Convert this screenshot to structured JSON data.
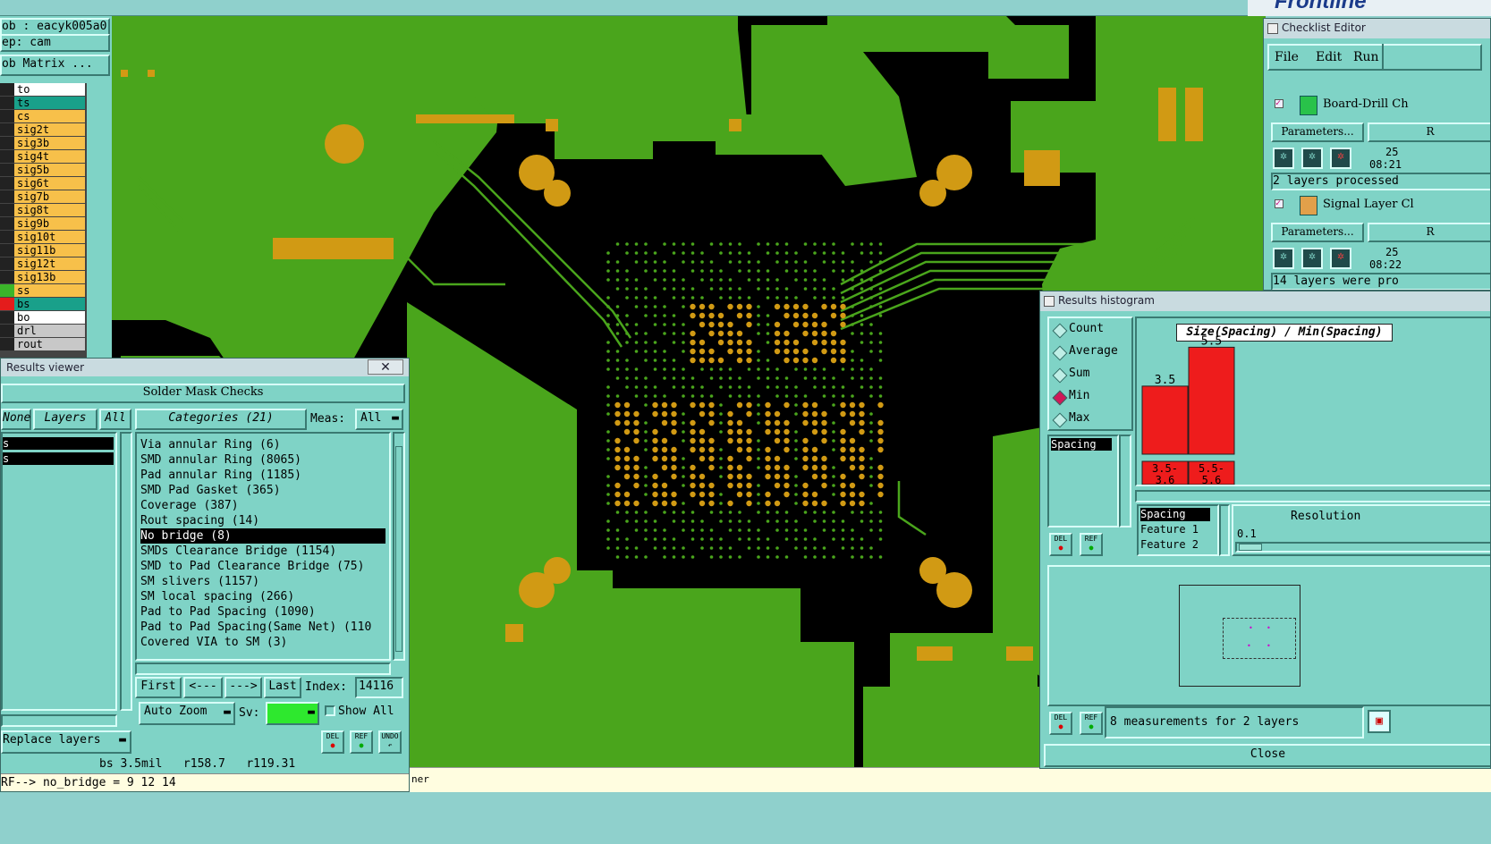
{
  "colors": {
    "pcb_bg": "#000000",
    "copper": "#4aa51c",
    "pad": "#d19a14",
    "panel": "#7fd3c6",
    "select": "#000000",
    "bar": "#ee1c1c"
  },
  "job": {
    "name": "ob : eacyk005a0",
    "step": "ep: cam",
    "matrix_btn": "ob Matrix ..."
  },
  "layers": [
    {
      "name": "to",
      "color": "#ffffff"
    },
    {
      "name": "ts",
      "color": "#19a08a"
    },
    {
      "name": "cs",
      "color": "#f7c04a"
    },
    {
      "name": "sig2t",
      "color": "#f7c04a"
    },
    {
      "name": "sig3b",
      "color": "#f7c04a"
    },
    {
      "name": "sig4t",
      "color": "#f7c04a"
    },
    {
      "name": "sig5b",
      "color": "#f7c04a"
    },
    {
      "name": "sig6t",
      "color": "#f7c04a"
    },
    {
      "name": "sig7b",
      "color": "#f7c04a"
    },
    {
      "name": "sig8t",
      "color": "#f7c04a"
    },
    {
      "name": "sig9b",
      "color": "#f7c04a"
    },
    {
      "name": "sig10t",
      "color": "#f7c04a"
    },
    {
      "name": "sig11b",
      "color": "#f7c04a"
    },
    {
      "name": "sig12t",
      "color": "#f7c04a"
    },
    {
      "name": "sig13b",
      "color": "#f7c04a"
    },
    {
      "name": "ss",
      "color": "#f7c04a"
    },
    {
      "name": "bs",
      "color": "#19a08a"
    },
    {
      "name": "bo",
      "color": "#ffffff"
    },
    {
      "name": "drl",
      "color": "#c8c8c8"
    },
    {
      "name": "rout",
      "color": "#c8c8c8"
    }
  ],
  "results_viewer": {
    "title": "Results viewer",
    "header": "Solder Mask Checks",
    "none_btn": "None",
    "layers_btn": "Layers",
    "all_btn": "All",
    "categories_label": "Categories (21)",
    "meas_label": "Meas:",
    "meas_value": "All",
    "layer_items": [
      "s",
      "s"
    ],
    "categories": [
      "Via annular Ring (6)",
      "SMD annular Ring (8065)",
      "Pad annular Ring (1185)",
      "SMD Pad Gasket (365)",
      "Coverage (387)",
      "Rout spacing (14)",
      "No bridge (8)",
      "SMDs Clearance Bridge (1154)",
      "SMD to Pad Clearance Bridge (75)",
      "SM slivers (1157)",
      "SM local spacing (266)",
      "Pad to Pad Spacing (1090)",
      "Pad to Pad Spacing(Same Net) (110",
      "Covered VIA to SM (3)"
    ],
    "selected_index": 6,
    "first": "First",
    "prev": "<---",
    "next": "--->",
    "last": "Last",
    "index_label": "Index:",
    "index_value": "14116",
    "auto_zoom": "Auto Zoom",
    "sv_label": "Sv:",
    "show_all": "Show All",
    "replace_layers": "Replace layers",
    "del": "DEL",
    "ref": "REF",
    "undo": "UNDO",
    "status": "bs 3.5mil   r158.7   r119.31",
    "command": "RF--> no_bridge = 9 12 14"
  },
  "checklist": {
    "title": "Checklist Editor",
    "menu": [
      "File",
      "Edit",
      "Run"
    ],
    "items": [
      {
        "name": "Board-Drill Ch",
        "params": "Parameters...",
        "r": "R",
        "date": "25",
        "time": "08:21",
        "msg": "2 layers processed"
      },
      {
        "name": "Signal Layer Cl",
        "params": "Parameters...",
        "r": "R",
        "date": "25",
        "time": "08:22",
        "msg": "14 layers were pro"
      }
    ]
  },
  "histogram": {
    "title": "Results histogram",
    "modes": [
      "Count",
      "Average",
      "Sum",
      "Min",
      "Max"
    ],
    "selected_mode": "Min",
    "chart_title": "Size(Spacing) / Min(Spacing)",
    "list_item": "Spacing",
    "fields": [
      "Spacing",
      "Feature 1",
      "Feature 2"
    ],
    "resolution_label": "Resolution",
    "resolution_value": "0.1",
    "measurements": "8 measurements for 2 layers",
    "close": "Close",
    "del": "DEL",
    "ref": "REF"
  },
  "chart_data": {
    "type": "bar",
    "categories": [
      "3.5-\n3.6",
      "5.5-\n5.6"
    ],
    "values": [
      3.5,
      5.5
    ],
    "title": "Size(Spacing) / Min(Spacing)",
    "ylim": [
      0,
      6
    ]
  },
  "bottom_hint": "ner",
  "brand": "Frontline"
}
